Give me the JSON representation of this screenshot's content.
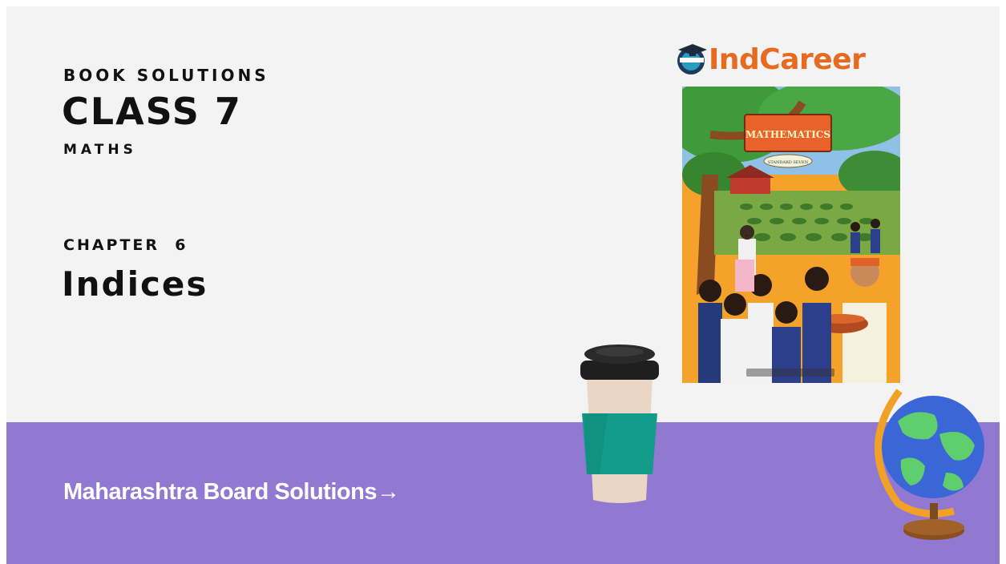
{
  "header": {
    "kicker": "BOOK SOLUTIONS",
    "class": "CLASS 7",
    "subject": "MATHS"
  },
  "chapter": {
    "label": "CHAPTER  6",
    "title": "Indices"
  },
  "footer": {
    "link_label": "Maharashtra Board Solutions→"
  },
  "logo": {
    "text": "IndCareer"
  },
  "book_cover": {
    "title": "MATHEMATICS",
    "subtitle": "STANDARD SEVEN"
  },
  "colors": {
    "background": "#f3f3f3",
    "band": "#9179d1",
    "brand": "#e66a1f",
    "text": "#111111"
  }
}
